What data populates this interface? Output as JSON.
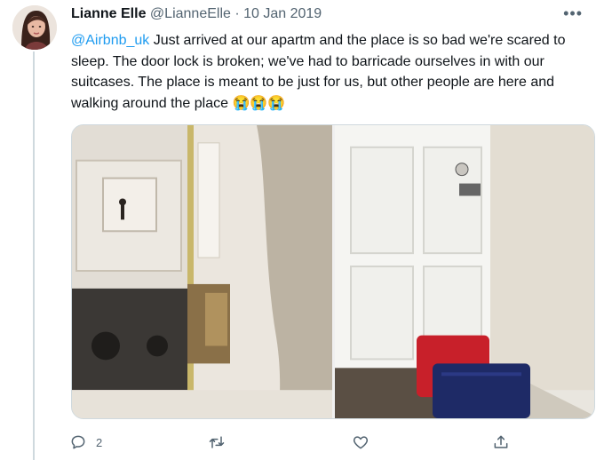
{
  "author": {
    "name": "Lianne Elle",
    "handle": "@LianneElle",
    "separator": "·",
    "date": "10 Jan 2019"
  },
  "more_label": "•••",
  "tweet": {
    "mention": "@Airbnb_uk",
    "body": " Just arrived at our apartm and the place is so bad we're scared to sleep. The door lock is broken; we've had to barricade ourselves in with our suitcases. The place is meant to be just for us, but other people are here and walking around the place ",
    "emojis": "😭😭😭"
  },
  "media": {
    "images": [
      "broken-door-lock-photo",
      "door-barricaded-with-suitcases-photo"
    ]
  },
  "actions": {
    "reply_count": "2",
    "retweet_count": "",
    "like_count": ""
  },
  "colors": {
    "accent": "#1d9bf0",
    "secondary_text": "#536471",
    "primary_text": "#0f1419"
  }
}
